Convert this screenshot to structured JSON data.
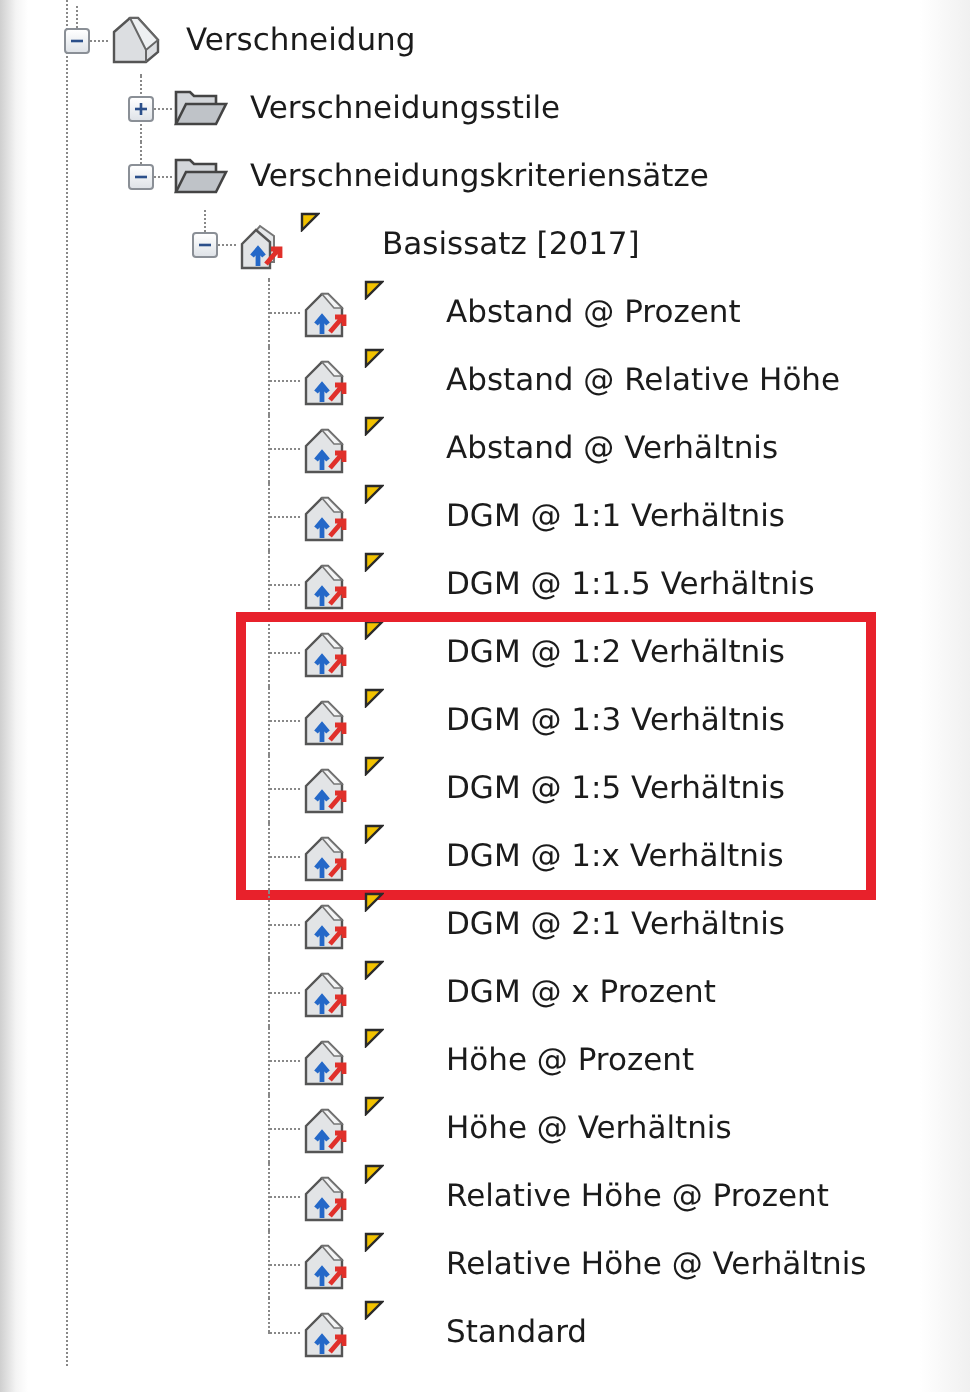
{
  "tree": {
    "nodes": [
      {
        "label": "Verschneidung",
        "kind": "grading",
        "expanded": true,
        "children": [
          {
            "label": "Verschneidungsstile",
            "kind": "folder",
            "expanded": false
          },
          {
            "label": "Verschneidungskriteriensätze",
            "kind": "folder",
            "expanded": true,
            "children": [
              {
                "label": "Basissatz [2017]",
                "kind": "set",
                "expanded": true,
                "children": [
                  {
                    "label": "Abstand @ Prozent",
                    "kind": "criterion",
                    "highlighted": false
                  },
                  {
                    "label": "Abstand @ Relative Höhe",
                    "kind": "criterion",
                    "highlighted": false
                  },
                  {
                    "label": "Abstand @ Verhältnis",
                    "kind": "criterion",
                    "highlighted": false
                  },
                  {
                    "label": "DGM @ 1:1 Verhältnis",
                    "kind": "criterion",
                    "highlighted": false
                  },
                  {
                    "label": "DGM @ 1:1.5 Verhältnis",
                    "kind": "criterion",
                    "highlighted": false
                  },
                  {
                    "label": "DGM @ 1:2 Verhältnis",
                    "kind": "criterion",
                    "highlighted": true
                  },
                  {
                    "label": "DGM @ 1:3 Verhältnis",
                    "kind": "criterion",
                    "highlighted": true
                  },
                  {
                    "label": "DGM @ 1:5 Verhältnis",
                    "kind": "criterion",
                    "highlighted": true
                  },
                  {
                    "label": "DGM @ 1:x Verhältnis",
                    "kind": "criterion",
                    "highlighted": true
                  },
                  {
                    "label": "DGM @ 2:1 Verhältnis",
                    "kind": "criterion",
                    "highlighted": false
                  },
                  {
                    "label": "DGM @ x Prozent",
                    "kind": "criterion",
                    "highlighted": false
                  },
                  {
                    "label": "Höhe @ Prozent",
                    "kind": "criterion",
                    "highlighted": false
                  },
                  {
                    "label": "Höhe @ Verhältnis",
                    "kind": "criterion",
                    "highlighted": false
                  },
                  {
                    "label": "Relative Höhe @ Prozent",
                    "kind": "criterion",
                    "highlighted": false
                  },
                  {
                    "label": "Relative Höhe @ Verhältnis",
                    "kind": "criterion",
                    "highlighted": false
                  },
                  {
                    "label": "Standard",
                    "kind": "criterion",
                    "highlighted": false
                  }
                ]
              }
            ]
          }
        ]
      }
    ]
  }
}
